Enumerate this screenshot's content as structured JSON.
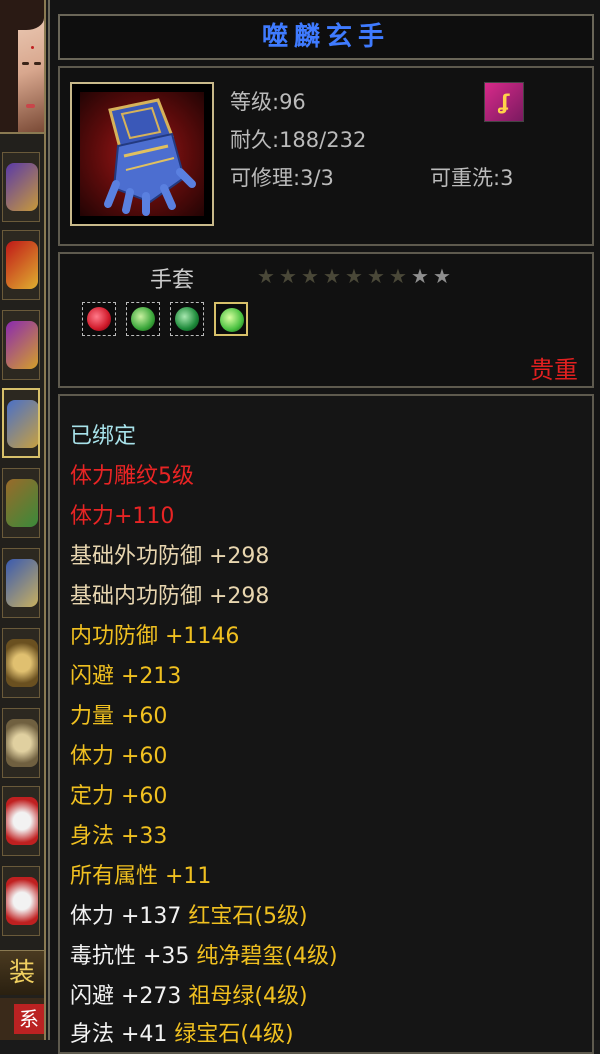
{
  "item": {
    "name": "噬麟玄手",
    "level": "等级:96",
    "durability": "耐久:188/232",
    "repair": "可修理:3/3",
    "rewash": "可重洗:3",
    "type": "手套",
    "rarity": "贵重",
    "stars_total": 9,
    "stars_lit": 2,
    "skill_badge_icon": "fire-skill-icon"
  },
  "gems": [
    {
      "name": "red-gem",
      "color": "#d01a2a"
    },
    {
      "name": "green-gem",
      "color": "#3aa63a"
    },
    {
      "name": "jade-gem",
      "color": "#1d8a3a"
    },
    {
      "name": "emerald-gem",
      "color": "#48c040"
    }
  ],
  "attributes": {
    "bound": "已绑定",
    "engrave": "体力雕纹5级",
    "engrave_bonus": "体力+110",
    "base_outer_def": "基础外功防御 +298",
    "base_inner_def": "基础内功防御 +298",
    "inner_def": "内功防御 +1146",
    "dodge": "闪避 +213",
    "strength": "力量 +60",
    "stamina": "体力 +60",
    "focus": "定力 +60",
    "agility": "身法 +33",
    "all_attr": "所有属性 +11",
    "gem1_stat": "体力 +137",
    "gem1_name": "红宝石(5级)",
    "gem2_stat": "毒抗性 +35",
    "gem2_name": "纯净碧玺(4级)",
    "gem3_stat": "闪避 +273",
    "gem3_name": "祖母绿(4级)",
    "gem4_stat": "身法 +41",
    "gem4_name": "绿宝石(4级)"
  },
  "left_panel": {
    "tab_label": "装备",
    "tab2_label": "系"
  },
  "colors": {
    "title": "#3f7bff",
    "rarity": "#e12020",
    "bound": "#a8e2ea",
    "engrave": "#e82424",
    "base_def": "#e8d6b0",
    "bonus": "#f0c020"
  }
}
